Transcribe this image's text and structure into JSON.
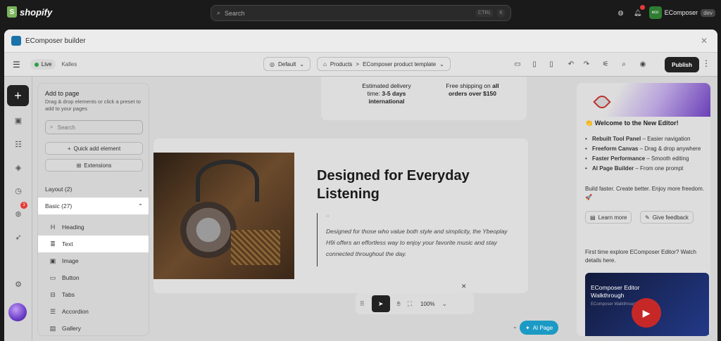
{
  "topbar": {
    "brand": "shopify",
    "search_placeholder": "Search",
    "shortcut_ctrl": "CTRL",
    "shortcut_key": "K",
    "account_initials": "eco",
    "account_name": "EComposer",
    "account_tag": "dev"
  },
  "modal": {
    "title": "EComposer builder"
  },
  "toolbar": {
    "status": "Live",
    "store": "Kalles",
    "device_preset": "Default",
    "breadcrumb_parent": "Products",
    "breadcrumb_separator": ">",
    "breadcrumb_current": "EComposer product template",
    "publish_label": "Publish"
  },
  "rail": {
    "badge_count": "3"
  },
  "add_panel": {
    "title": "Add to page",
    "subtitle": "Drag & drop elements or click a preset to add to your pages",
    "search_placeholder": "Search",
    "quick_add_label": "Quick add element",
    "extensions_label": "Extensions",
    "sections": [
      {
        "label": "Layout (2)"
      },
      {
        "label": "Basic (27)"
      }
    ],
    "elements": [
      {
        "label": "Heading",
        "icon": "H"
      },
      {
        "label": "Text",
        "icon": "≣"
      },
      {
        "label": "Image",
        "icon": "▣"
      },
      {
        "label": "Button",
        "icon": "▭"
      },
      {
        "label": "Tabs",
        "icon": "⊟"
      },
      {
        "label": "Accordion",
        "icon": "☰"
      },
      {
        "label": "Gallery",
        "icon": "▤"
      }
    ]
  },
  "canvas": {
    "ship1_line1": "Estimated delivery",
    "ship1_line2": "time: ",
    "ship1_bold1": "3-5 days",
    "ship1_bold2": "international",
    "ship2_line1": "Free shipping on ",
    "ship2_bold1": "all",
    "ship2_bold2": "orders over $150",
    "title": "Designed for Everyday Listening",
    "quote_mark": "“",
    "quote_text": "Designed for those who value both style and simplicity, the Ybeoplay H9i offers an effortless way to enjoy your favorite music and stay connected throughout the day.",
    "zoom": "100%",
    "ai_page_label": "AI Page"
  },
  "right_panel": {
    "heading": "Welcome to the New Editor!",
    "features": [
      {
        "bold": "Rebuilt Tool Panel",
        "rest": " – Easier navigation"
      },
      {
        "bold": "Freeform Canvas",
        "rest": " – Drag & drop anywhere"
      },
      {
        "bold": "Faster Performance",
        "rest": " – Smooth editing"
      },
      {
        "bold": "AI Page Builder",
        "rest": " – From one prompt"
      }
    ],
    "tagline": "Build faster. Create better. Enjoy more freedom. 🚀",
    "learn_more": "Learn more",
    "give_feedback": "Give feedback",
    "explore_text": "First time explore EComposer Editor? Watch details here.",
    "video_title": "EComposer Editor Walkthrough",
    "video_sub": "EComposer Walkthrough"
  }
}
